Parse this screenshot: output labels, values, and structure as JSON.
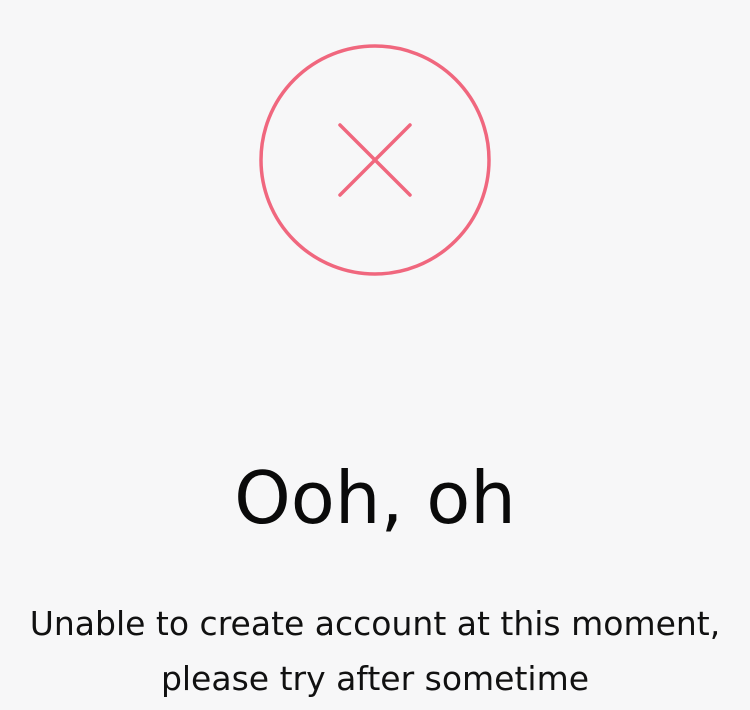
{
  "error": {
    "icon": "close-circle-icon",
    "accent_color": "#f0677e",
    "title": "Ooh, oh",
    "message": "Unable to create account at this moment, please try after sometime"
  }
}
